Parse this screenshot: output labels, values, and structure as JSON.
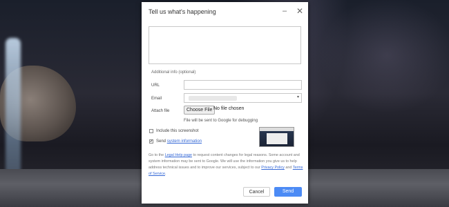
{
  "dialog": {
    "title": "Tell us what's happening",
    "minimize_glyph": "–",
    "close_glyph": "✕"
  },
  "form": {
    "additional_info_label": "Additional info (optional)",
    "url_label": "URL",
    "email_label": "Email",
    "attach_label": "Attach file",
    "choose_file_label": "Choose File",
    "no_file_text": "No file chosen",
    "file_note": "File will be sent to Google for debugging",
    "include_screenshot_label": "Include this screenshot",
    "include_screenshot_checked": false,
    "send_label_prefix": "Send ",
    "send_system_info_link": "system information",
    "send_system_info_checked": true
  },
  "legal": {
    "part1": "Go to the ",
    "legal_help_link": "Legal Help page",
    "part2": " to request content changes for legal reasons. Some account and system information may be sent to Google. We will use the information you give us to help address technical issues and to improve our services, subject to our ",
    "privacy_link": "Privacy Policy",
    "part3": " and ",
    "terms_link": "Terms of Service",
    "part4": "."
  },
  "buttons": {
    "cancel_label": "Cancel",
    "send_label": "Send"
  },
  "icons": {
    "minimize": "minimize-icon",
    "close": "close-icon",
    "dropdown": "chevron-down-icon",
    "check": "check-icon"
  },
  "colors": {
    "accent": "#4c8bf5",
    "link": "#3367d6"
  }
}
